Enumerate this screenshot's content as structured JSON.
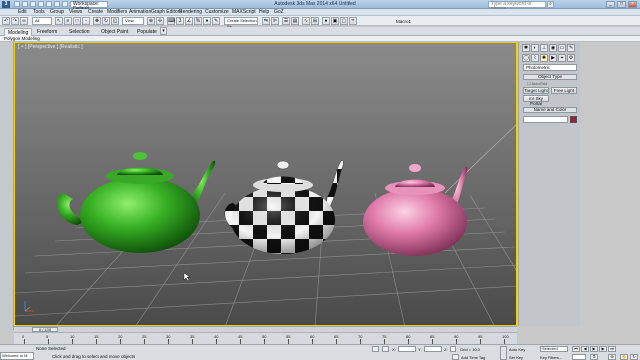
{
  "title_bar": {
    "logo": "3",
    "workspace_select": "Workspace: Default",
    "title": "Autodesk 3ds Max 2014 x64    Untitled",
    "search_placeholder": "Type a keyword or phrase",
    "search_icon": "search-icon",
    "window_buttons": [
      "_",
      "□",
      "×"
    ]
  },
  "menu_bar": {
    "items": [
      "Edit",
      "Tools",
      "Group",
      "Views",
      "Create",
      "Modifiers",
      "Animation",
      "Graph Editors",
      "Rendering",
      "Customize",
      "MAXScript",
      "Help",
      "GoZ"
    ]
  },
  "main_toolbar": {
    "filter_select": "All",
    "view_select": "View",
    "selection_set": "Create Selection Se",
    "macro_label": "Macro1"
  },
  "ribbon": {
    "tabs": [
      "Modeling",
      "Freeform",
      "Selection",
      "Object Paint",
      "Populate"
    ],
    "active_tab": "Modeling",
    "panel_label": "Polygon Modeling"
  },
  "viewport": {
    "label": "[ + ] [Perspective ] [Realistic ]",
    "teapots": [
      {
        "name": "green-teapot",
        "color": "#2e9a1e"
      },
      {
        "name": "checker-teapot",
        "color": "#ffffff"
      },
      {
        "name": "pink-teapot",
        "color": "#e27ba8"
      }
    ],
    "border_color": "#f0d000"
  },
  "command_panel": {
    "category_select": "Photometric",
    "object_type_rollout": "Object Type",
    "autogrid_label": "AutoGrid",
    "buttons": [
      "Target Light",
      "Free Light",
      "mr Sky Portal"
    ],
    "name_color_rollout": "Name and Color",
    "object_color": "#a01c3c"
  },
  "timeline": {
    "slider_label": "0 / 100",
    "ticks": [
      "0",
      "5",
      "10",
      "15",
      "20",
      "25",
      "30",
      "35",
      "40",
      "45",
      "50",
      "55",
      "60",
      "65",
      "70",
      "75",
      "80",
      "85",
      "90",
      "95",
      "100"
    ]
  },
  "status_bar": {
    "maxscript_text": "Welcome to M",
    "selection_status": "None Selected",
    "prompt": "Click and drag to select and move objects",
    "x_label": "X:",
    "y_label": "Y:",
    "z_label": "Z:",
    "grid_label": "Grid = 10,0",
    "add_time_tag": "Add Time Tag",
    "auto_key": "Auto Key",
    "set_key": "Set Key",
    "key_filters": "Key Filters...",
    "selected_select": "Selected"
  }
}
